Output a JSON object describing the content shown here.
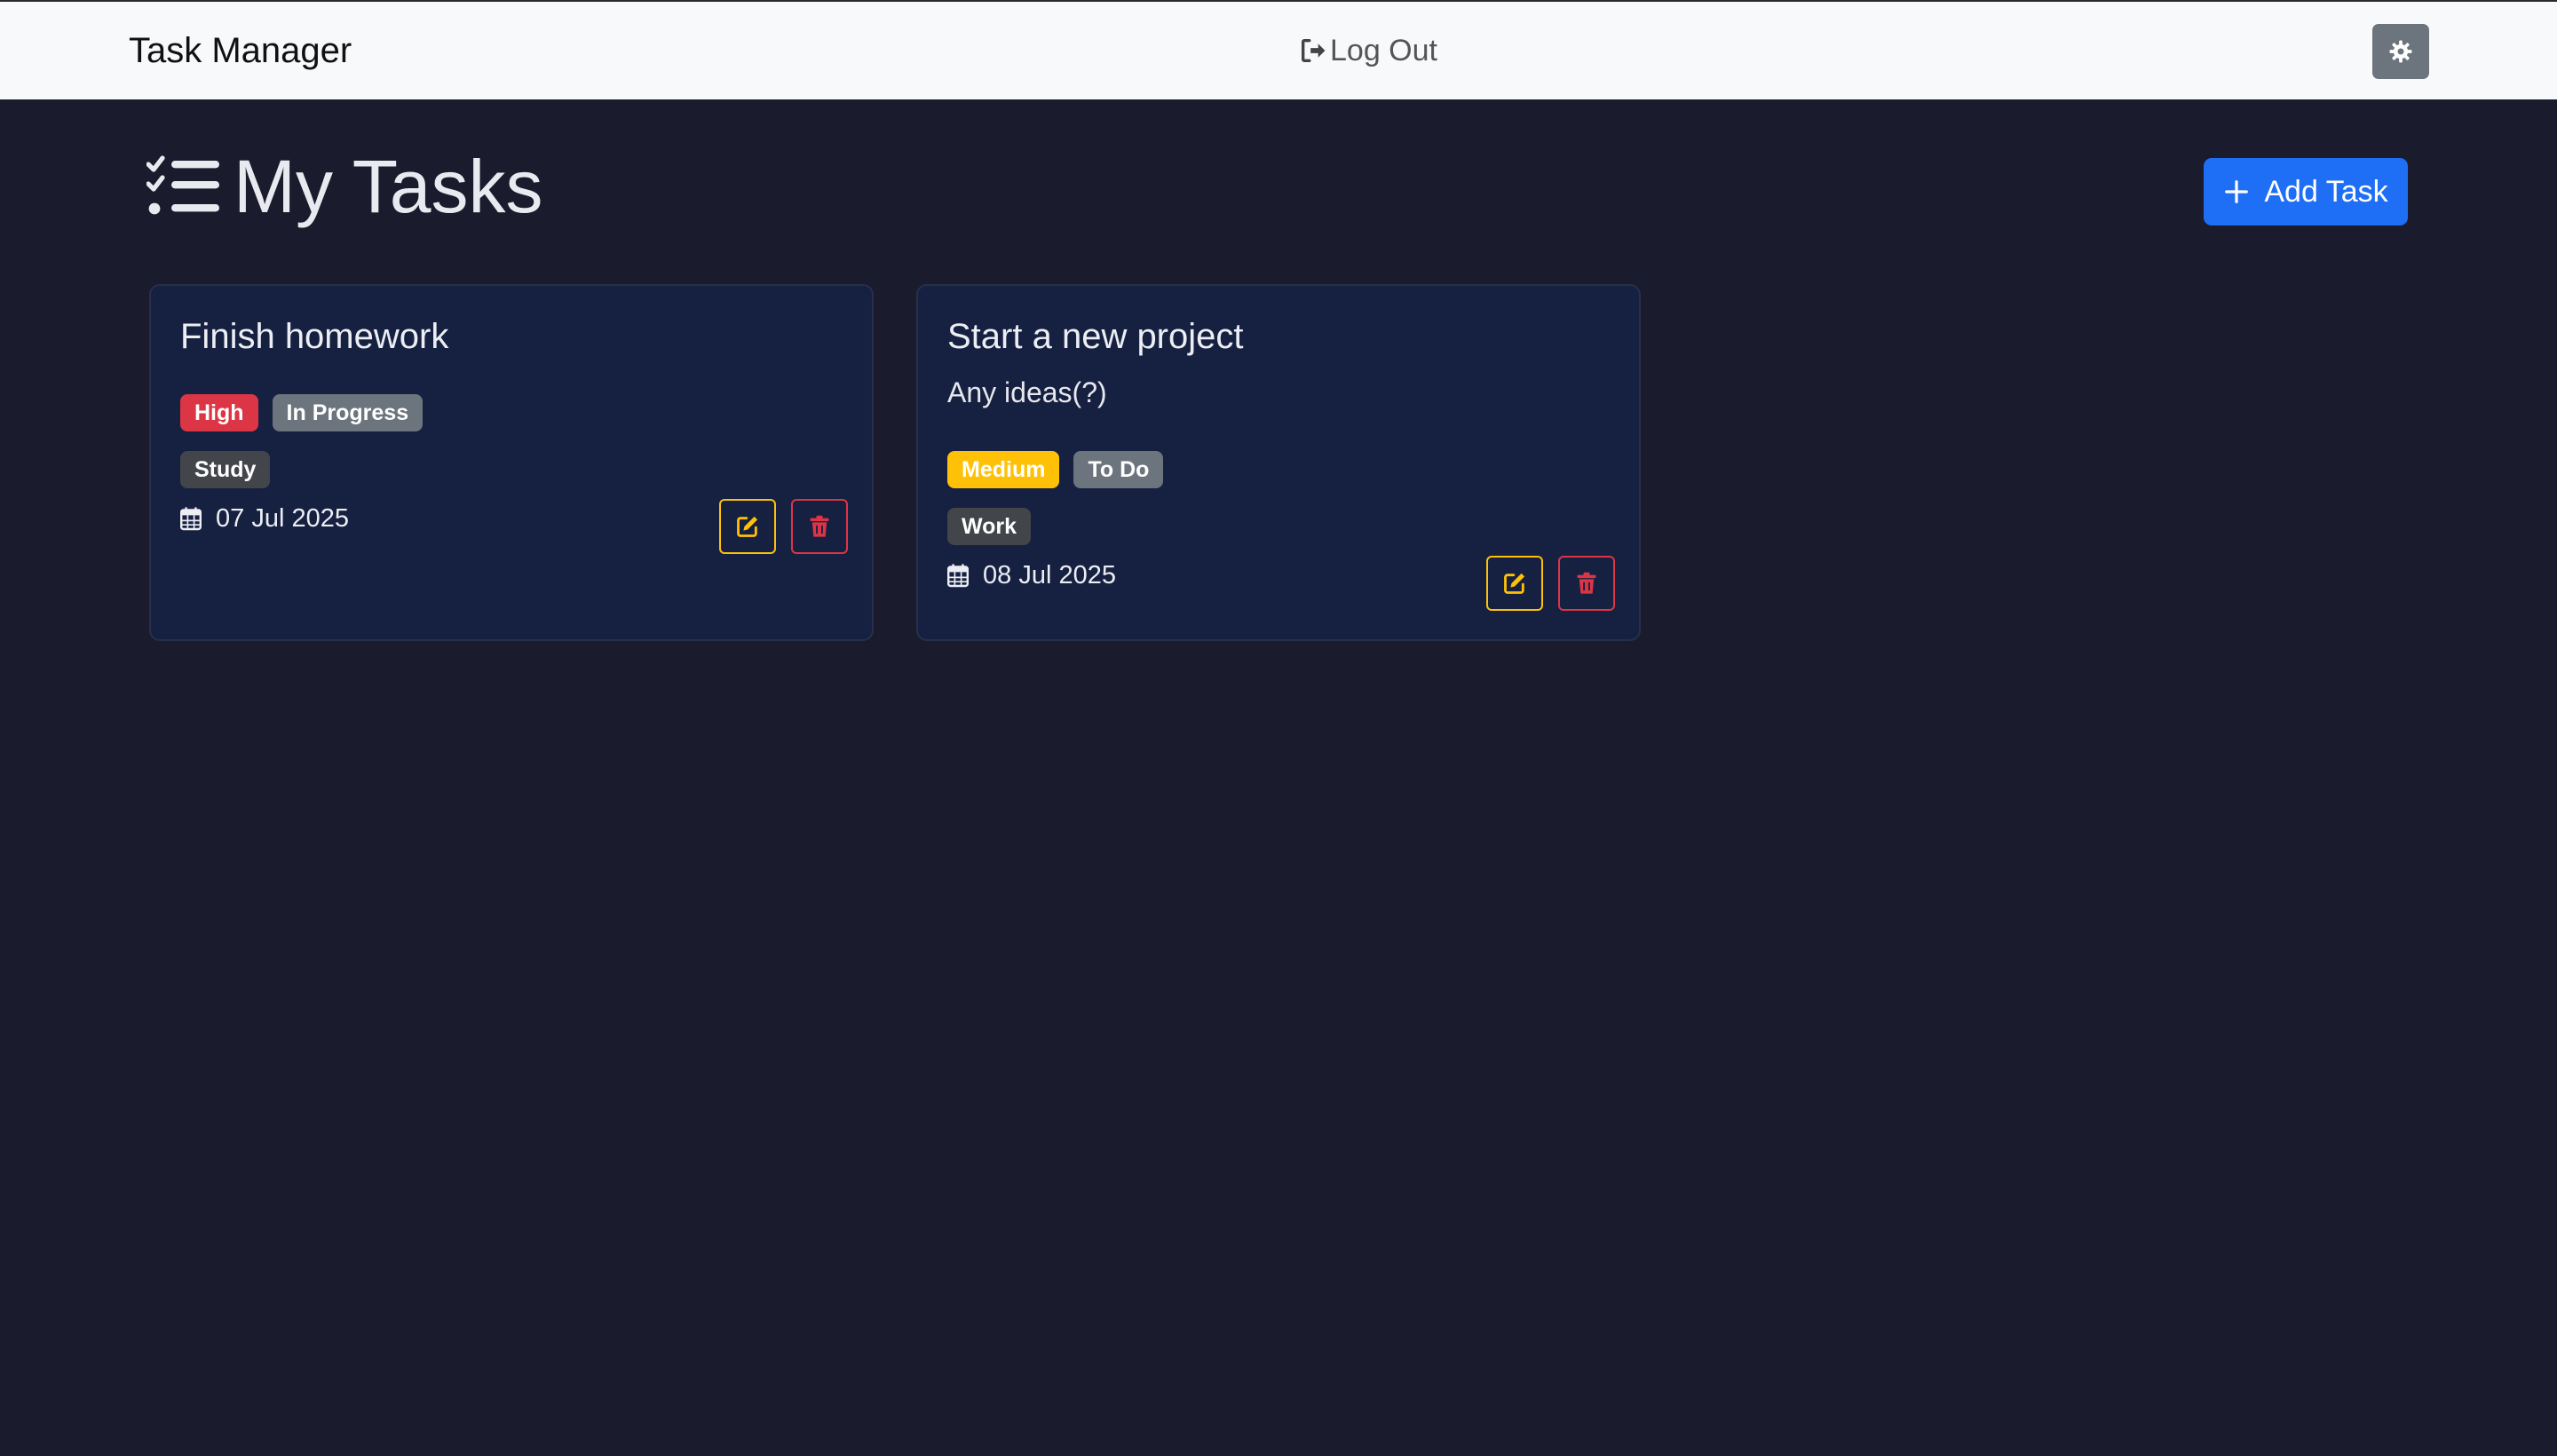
{
  "navbar": {
    "brand": "Task Manager",
    "logout_label": "Log Out",
    "theme_icon": "gear-icon"
  },
  "page": {
    "title": "My Tasks",
    "add_button_label": "Add Task"
  },
  "colors": {
    "background": "#1a1b2c",
    "card": "#162040",
    "primary": "#1e6ff5",
    "danger": "#dc3545",
    "warning": "#ffc107",
    "secondary": "#6c757d"
  },
  "tasks": [
    {
      "title": "Finish homework",
      "description": "",
      "priority": "High",
      "status": "In Progress",
      "category": "Study",
      "date": "07 Jul 2025"
    },
    {
      "title": "Start a new project",
      "description": "Any ideas(?)",
      "priority": "Medium",
      "status": "To Do",
      "category": "Work",
      "date": "08 Jul 2025"
    }
  ]
}
